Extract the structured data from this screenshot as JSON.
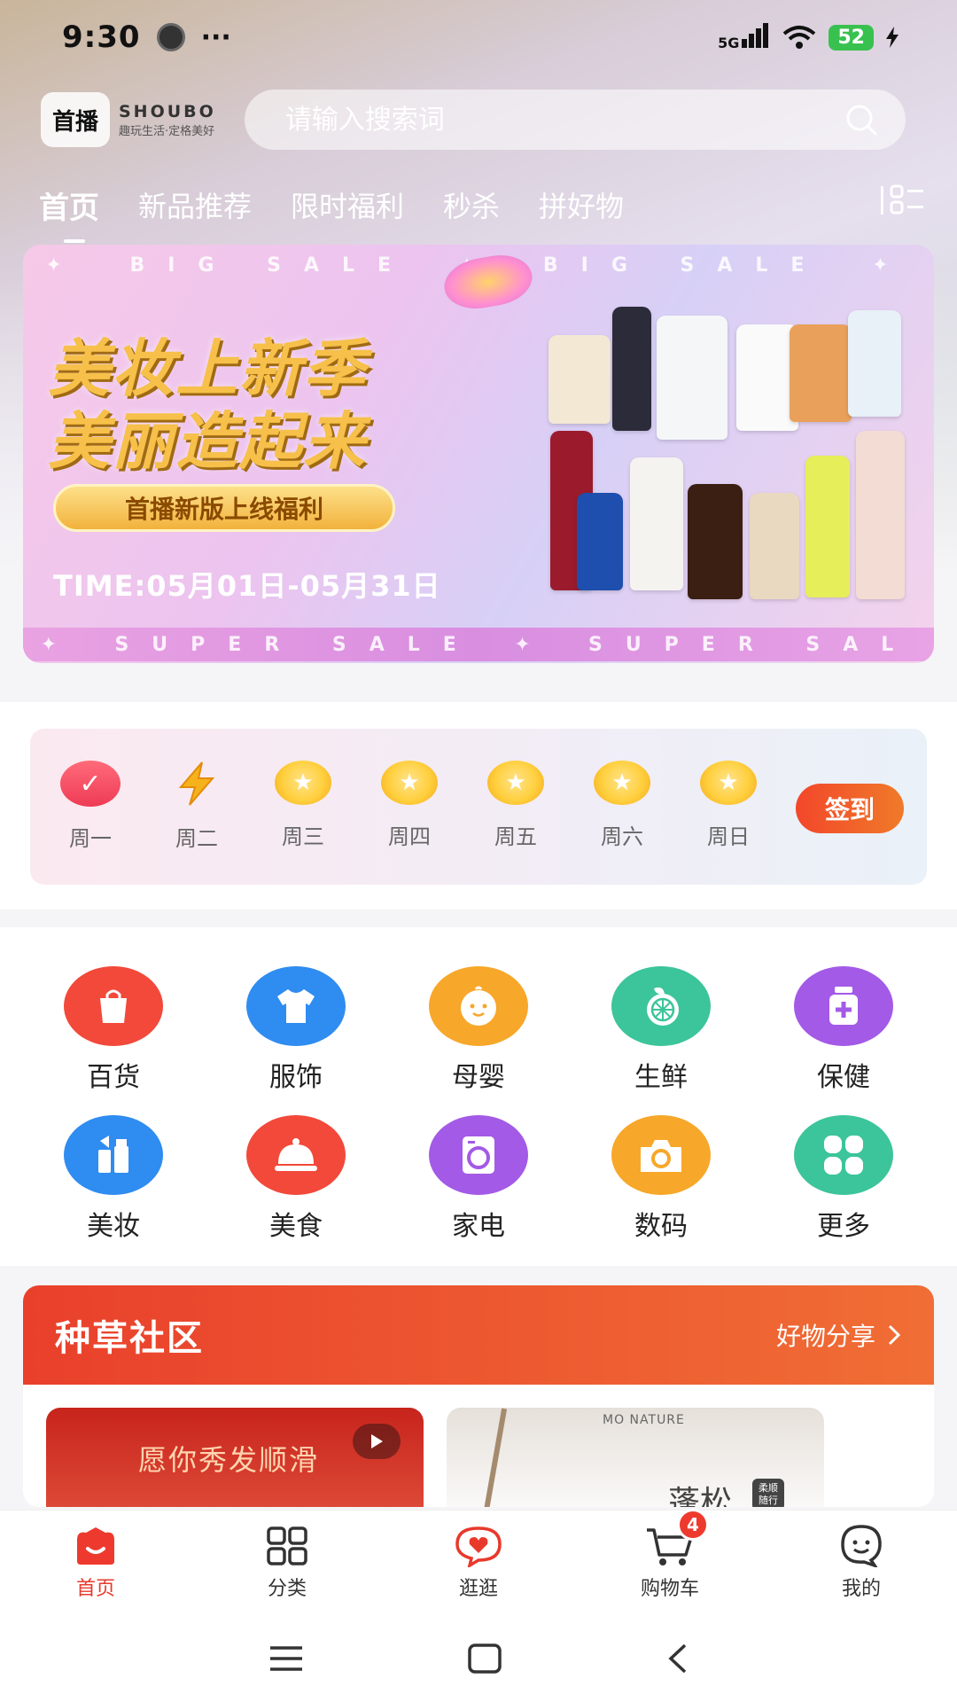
{
  "status_bar": {
    "time": "9:30",
    "more": "···",
    "network": "5G",
    "battery": "52"
  },
  "header": {
    "logo_cn": "首播",
    "logo_en": "SHOUBO",
    "logo_slogan": "趣玩生活·定格美好",
    "search_placeholder": "请输入搜索词"
  },
  "tabs": [
    "首页",
    "新品推荐",
    "限时福利",
    "秒杀",
    "拼好物"
  ],
  "banner": {
    "strip_top": [
      "✦",
      "BIG SALE",
      "✦",
      "BIG SALE",
      "✦"
    ],
    "title_line1": "美妆上新季",
    "title_line2": "美丽造起来",
    "pill": "首播新版上线福利",
    "time": "TIME:05月01日-05月31日",
    "strip_bottom": [
      "✦",
      "SUPER SALE",
      "✦",
      "SUPER SAL"
    ]
  },
  "checkin": {
    "days": [
      "周一",
      "周二",
      "周三",
      "周四",
      "周五",
      "周六",
      "周日"
    ],
    "button": "签到"
  },
  "categories": [
    {
      "label": "百货",
      "icon": "shopping-bag-icon",
      "color": "#f2493a"
    },
    {
      "label": "服饰",
      "icon": "tshirt-icon",
      "color": "#2f8cf0"
    },
    {
      "label": "母婴",
      "icon": "baby-face-icon",
      "color": "#f7a72a"
    },
    {
      "label": "生鲜",
      "icon": "lemon-icon",
      "color": "#3cc49a"
    },
    {
      "label": "保健",
      "icon": "medicine-bottle-icon",
      "color": "#a35ae6"
    },
    {
      "label": "美妆",
      "icon": "cosmetics-icon",
      "color": "#2f8cf0"
    },
    {
      "label": "美食",
      "icon": "food-cloche-icon",
      "color": "#f2493a"
    },
    {
      "label": "家电",
      "icon": "washing-machine-icon",
      "color": "#a35ae6"
    },
    {
      "label": "数码",
      "icon": "camera-icon",
      "color": "#f7a72a"
    },
    {
      "label": "更多",
      "icon": "grid-icon",
      "color": "#3cc49a"
    }
  ],
  "community": {
    "title": "种草社区",
    "more": "好物分享",
    "post1_text": "愿你秀发顺滑",
    "post2_brand": "MO NATURE",
    "post2_title": "蓬松",
    "post2_seal": "柔顺 随行"
  },
  "bottom_nav": [
    {
      "label": "首页",
      "icon": "home-icon",
      "active": true
    },
    {
      "label": "分类",
      "icon": "category-grid-icon"
    },
    {
      "label": "逛逛",
      "icon": "heart-chat-icon"
    },
    {
      "label": "购物车",
      "icon": "cart-icon",
      "badge": "4"
    },
    {
      "label": "我的",
      "icon": "profile-icon"
    }
  ],
  "colors": {
    "accent": "#e8392b",
    "signin_gradient_start": "#f2472a",
    "signin_gradient_end": "#f07a2a"
  }
}
